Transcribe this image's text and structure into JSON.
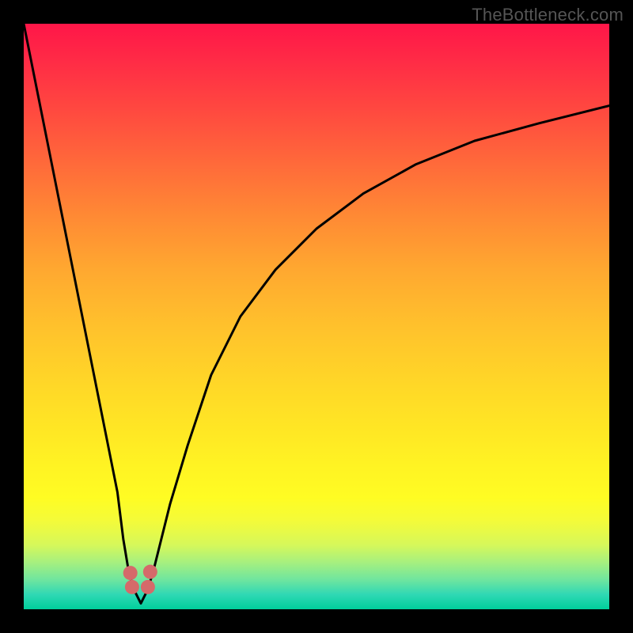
{
  "watermark": "TheBottleneck.com",
  "chart_data": {
    "type": "line",
    "title": "",
    "xlabel": "",
    "ylabel": "",
    "xlim": [
      0,
      100
    ],
    "ylim": [
      0,
      100
    ],
    "grid": false,
    "series": [
      {
        "name": "bottleneck-curve",
        "x": [
          0,
          2,
          4,
          6,
          8,
          10,
          12,
          14,
          16,
          17,
          18,
          19,
          20,
          21,
          22,
          23,
          25,
          28,
          32,
          37,
          43,
          50,
          58,
          67,
          77,
          88,
          100
        ],
        "values": [
          100,
          90,
          80,
          70,
          60,
          50,
          40,
          30,
          20,
          12,
          6,
          3,
          1,
          3,
          6,
          10,
          18,
          28,
          40,
          50,
          58,
          65,
          71,
          76,
          80,
          83,
          86
        ]
      }
    ],
    "markers": [
      {
        "name": "min-dot-left",
        "x": 18.5,
        "y": 3.8
      },
      {
        "name": "min-dot-up-left",
        "x": 18.2,
        "y": 6.2
      },
      {
        "name": "min-dot-right",
        "x": 21.2,
        "y": 3.8
      },
      {
        "name": "min-dot-up-right",
        "x": 21.6,
        "y": 6.4
      }
    ],
    "colors": {
      "curve": "#000000",
      "marker": "#d56a6a",
      "gradient_top": "#ff1648",
      "gradient_mid": "#ffd323",
      "gradient_bottom": "#00cf9b"
    }
  }
}
